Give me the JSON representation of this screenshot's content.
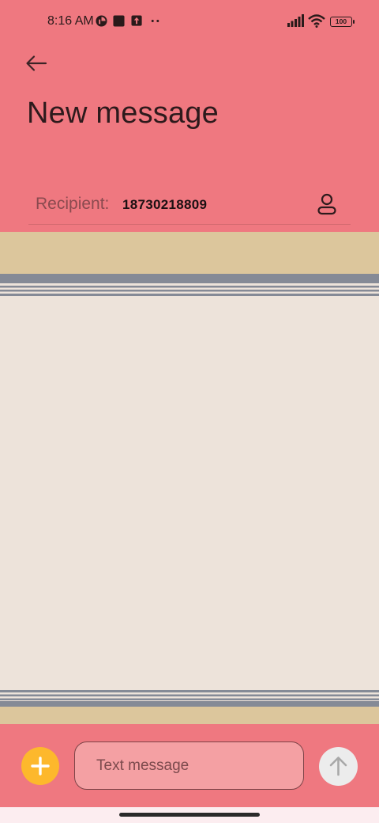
{
  "status_bar": {
    "time": "8:16 AM",
    "icons": [
      "app-notification-icon",
      "stop-square-icon",
      "upload-notification-icon",
      "more-dots-icon",
      "signal-icon",
      "wifi-icon"
    ],
    "battery": "100"
  },
  "header": {
    "back_icon": "arrow-left-icon",
    "title": "New message"
  },
  "recipient": {
    "label": "Recipient:",
    "value": "18730218809",
    "contact_icon": "person-icon"
  },
  "composer": {
    "add_icon": "plus-icon",
    "placeholder": "Text message",
    "send_icon": "arrow-up-icon"
  },
  "colors": {
    "header_bg": "#ef7880",
    "band": "#dcc69c",
    "content_bg": "#ede3da",
    "stripe": "#858a96",
    "accent": "#fdb82c",
    "input_bg": "#f4a0a3",
    "nav_bg": "#fcedf0"
  }
}
